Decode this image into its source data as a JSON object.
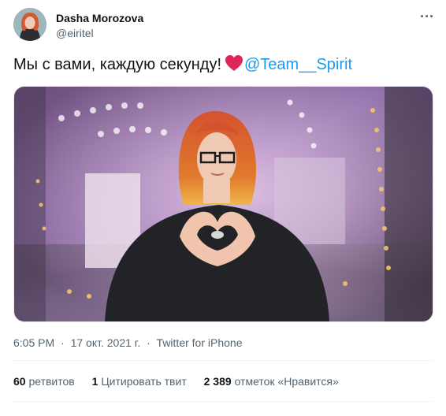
{
  "author": {
    "display_name": "Dasha Morozova",
    "handle": "@eiritel"
  },
  "tweet": {
    "text": "Мы с вами, каждую секунду!",
    "emoji": "heart",
    "mention": "@Team__Spirit"
  },
  "meta": {
    "time": "6:05 PM",
    "date": "17 окт. 2021 г.",
    "separator": "·",
    "source": "Twitter for iPhone"
  },
  "stats": {
    "retweets_count": "60",
    "retweets_label": "ретвитов",
    "quotes_count": "1",
    "quotes_label": "Цитировать твит",
    "likes_count": "2 389",
    "likes_label": "отметок «Нравится»"
  },
  "icons": {
    "more": "more-dots-icon",
    "heart": "red-heart-icon"
  },
  "colors": {
    "link": "#1d9bf0",
    "secondary_text": "#536471",
    "heart": "#e0245e"
  }
}
